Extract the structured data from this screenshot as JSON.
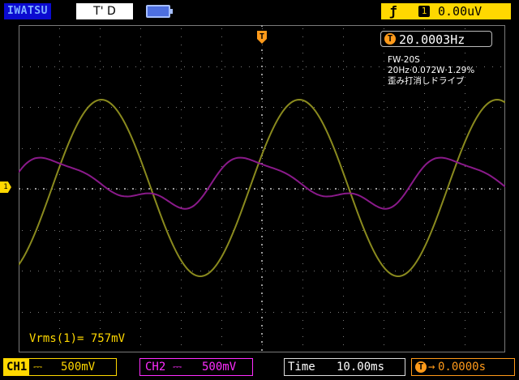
{
  "header": {
    "brand": "IWATSU",
    "trigger_status": "T' D",
    "trigger_edge": "ƒ",
    "trigger_channel": "1",
    "trigger_level": "0.00uV"
  },
  "screen": {
    "frequency_marker": "T",
    "frequency": "20.0003Hz",
    "annotation": {
      "line1": "FW-20S",
      "line2": "20Hz·0.072W·1.29%",
      "line3": "歪み打消しドライブ"
    },
    "measurement": "Vrms(1)= 757mV",
    "ch1_marker": "1",
    "trigger_position_marker": "T"
  },
  "footer": {
    "ch1": {
      "label": "CH1",
      "coupling": "⎓",
      "scale": "500mV"
    },
    "ch2": {
      "label": "CH2",
      "coupling": "⎓",
      "scale": "500mV"
    },
    "time": {
      "label": "Time",
      "value": "10.00ms"
    },
    "offset": {
      "marker": "T",
      "arrow": "→",
      "value": "0.0000s"
    }
  },
  "colors": {
    "ch1": "#8a8a1e",
    "ch2": "#8a1a8a",
    "trigger": "#ffd800",
    "accent": "#ff9a1a"
  },
  "waveforms": {
    "ch1": {
      "kind": "sine",
      "frequency_hz": 20,
      "vrms_mv": 757
    },
    "ch2": {
      "kind": "distorted-sine",
      "frequency_hz": 20
    }
  }
}
